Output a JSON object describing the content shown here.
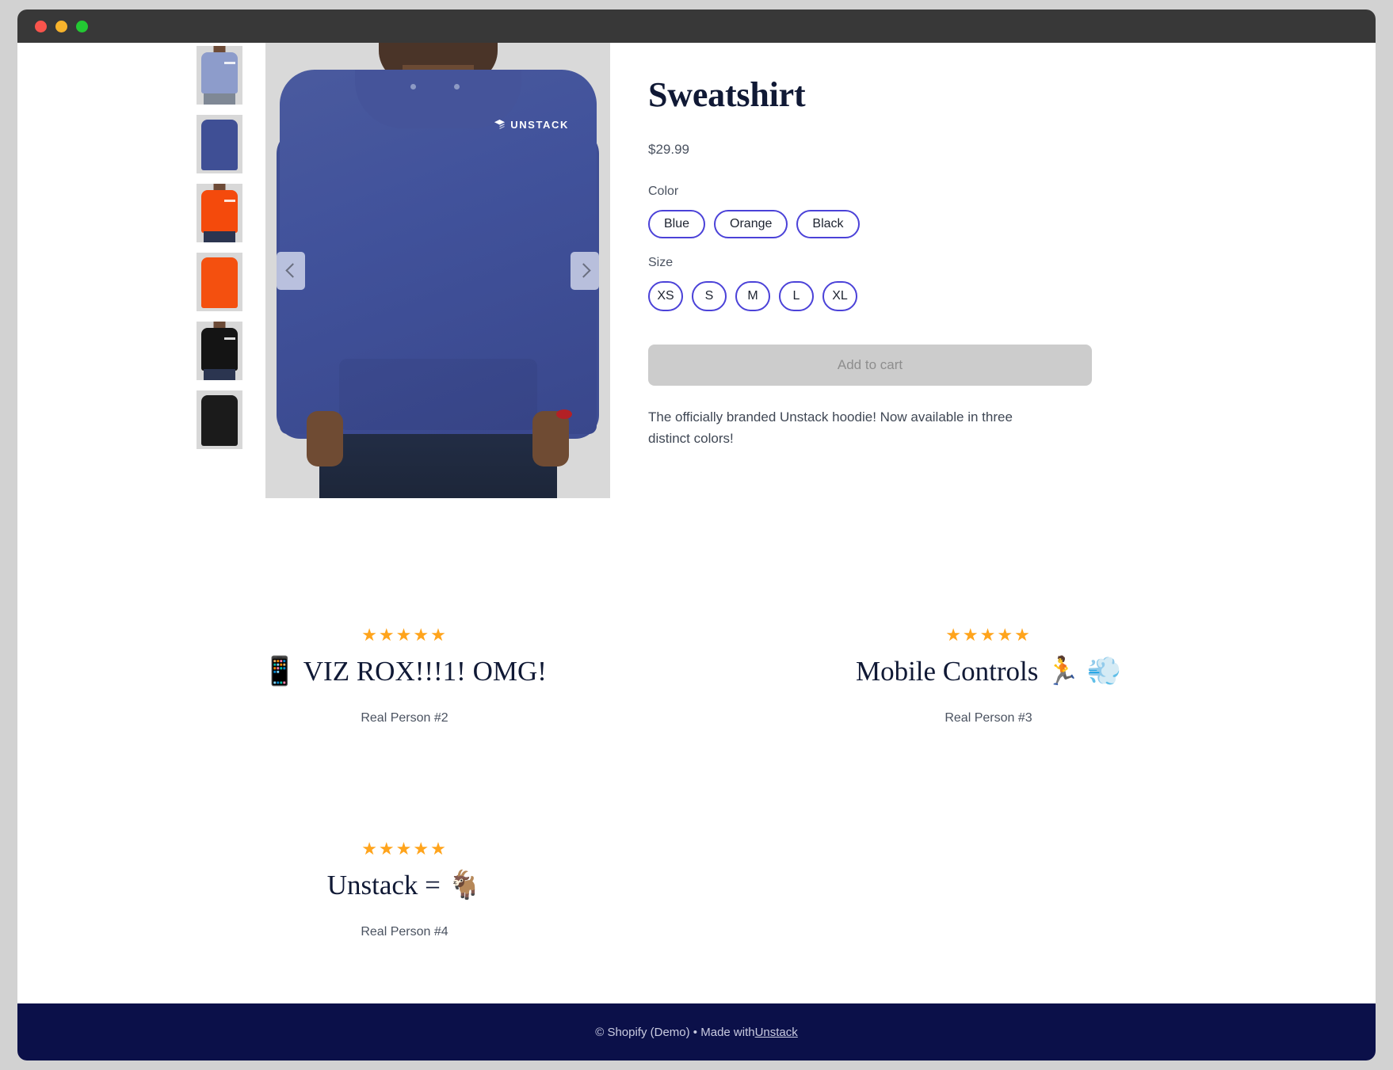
{
  "window": {
    "controls": [
      "close",
      "minimize",
      "maximize"
    ]
  },
  "product": {
    "title": "Sweatshirt",
    "price": "$29.99",
    "color_label": "Color",
    "colors": [
      "Blue",
      "Orange",
      "Black"
    ],
    "size_label": "Size",
    "sizes": [
      "XS",
      "S",
      "M",
      "L",
      "XL"
    ],
    "add_to_cart_label": "Add to cart",
    "description": "The officially branded Unstack hoodie! Now available in three distinct colors!",
    "brand_on_garment": "UNSTACK",
    "thumbnails": [
      {
        "alt": "blue-hoodie-front"
      },
      {
        "alt": "blue-hoodie-back"
      },
      {
        "alt": "orange-hoodie-front"
      },
      {
        "alt": "orange-hoodie-back"
      },
      {
        "alt": "black-hoodie-front"
      },
      {
        "alt": "black-hoodie-back"
      }
    ],
    "carousel": {
      "prev_label": "Previous image",
      "next_label": "Next image"
    }
  },
  "reviews": [
    {
      "stars": "★★★★★",
      "title": "📱 VIZ ROX!!!1! OMG!",
      "author": "Real Person #2"
    },
    {
      "stars": "★★★★★",
      "title": "Mobile Controls 🏃 💨",
      "author": "Real Person #3"
    },
    {
      "stars": "★★★★★",
      "title": "Unstack = 🐐",
      "author": "Real Person #4"
    }
  ],
  "footer": {
    "text": "© Shopify (Demo) • Made with ",
    "link_label": "Unstack"
  }
}
